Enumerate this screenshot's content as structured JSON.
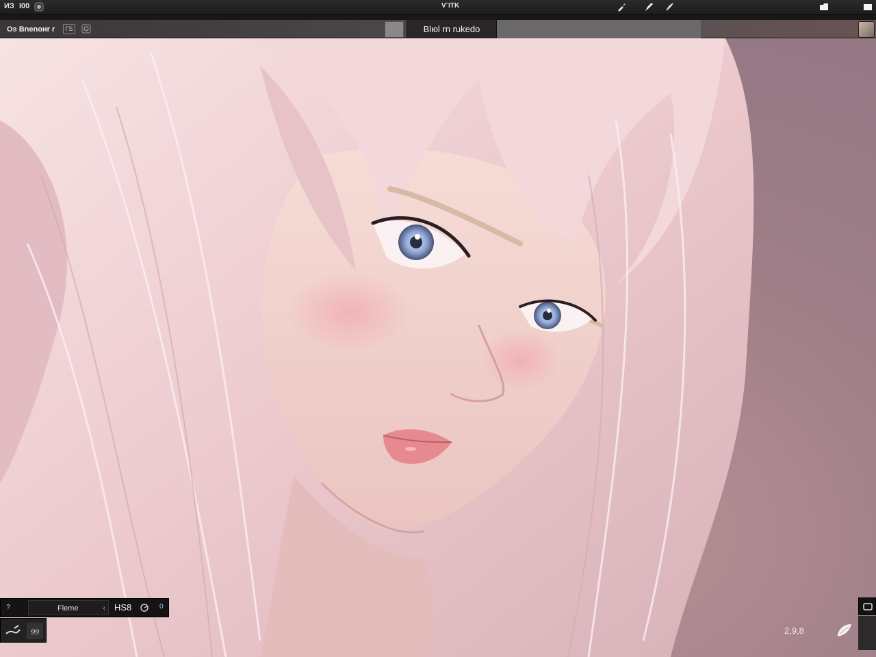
{
  "menubar": {
    "left_label": "ИЗ",
    "left_label_2": "Ι00",
    "center_label": "ѴΊΤΚ",
    "icons": [
      "app-icon",
      "brush-icon",
      "pen-icon",
      "feather-icon",
      "folder-icon",
      "window-icon"
    ]
  },
  "tabs": {
    "document_label": "Os Bnenoнr r",
    "badge_label": "ГS",
    "active_title": "Blюl  rn  rukedo"
  },
  "bottom_panel": {
    "help_label": "?",
    "field_label": "Fleme",
    "field_caret": "‹",
    "value_label": "HS8",
    "dial_suffix": "‹·",
    "counter": "0",
    "tool_1": "pen-tool-icon",
    "tool_2": "shape-tool-icon",
    "tool_2_label": "99"
  },
  "status": {
    "zoom_text": "2,9,8"
  },
  "colors": {
    "canvas_bg": "#9f7f88",
    "hair": "#f1d8dc",
    "skin": "#f4d3d0",
    "iris": "#8ea6d4"
  }
}
